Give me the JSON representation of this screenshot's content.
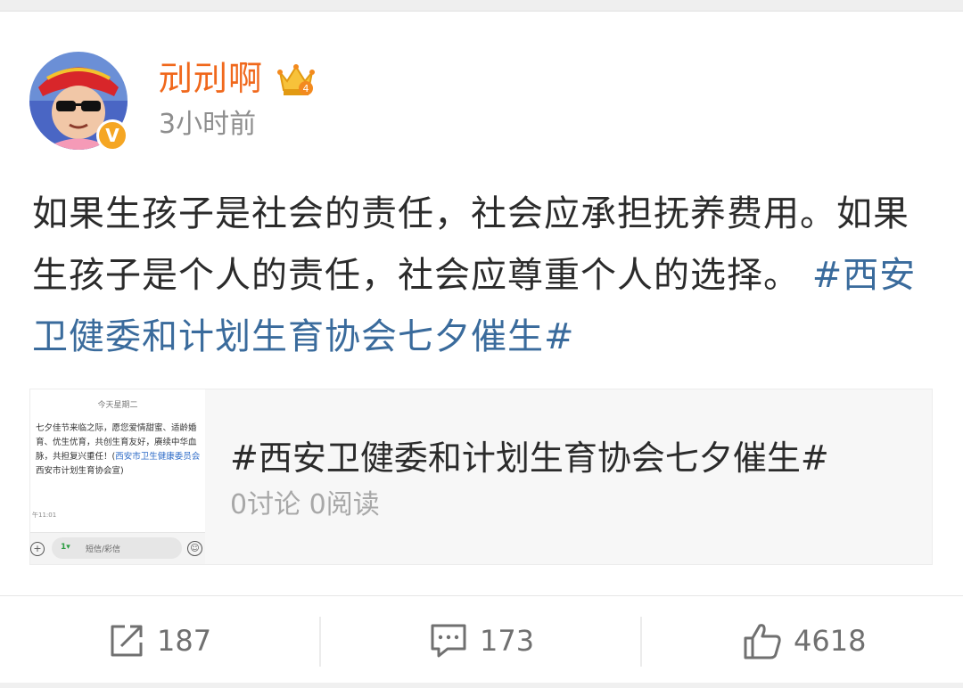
{
  "user": {
    "name": "刓刓啊",
    "time": "3小时前",
    "verify_mark": "V"
  },
  "post": {
    "text": "如果生孩子是社会的责任，社会应承担抚养费用。如果生孩子是个人的责任，社会应尊重个人的选择。",
    "hashtag": "#西安卫健委和计划生育协会七夕催生#"
  },
  "topic_card": {
    "title": "#西安卫健委和计划生育协会七夕催生#",
    "stats": "0讨论 0阅读",
    "thumbnail": {
      "header": "今天星期二",
      "message": "七夕佳节来临之际，愿您爱情甜蜜、适龄婚育、优生优育，共创生育友好，赓续中华血脉，共担复兴重任！(",
      "link": "西安市卫生健康委员会",
      "message_tail": "  西安市计划生育协会宣)",
      "time": "午11:01",
      "plus": "+",
      "sim": "1▾",
      "input_placeholder": "短信/彩信",
      "emoji": "☺"
    }
  },
  "actions": {
    "repost": "187",
    "comment": "173",
    "like": "4618"
  },
  "colors": {
    "username": "#f0681c",
    "hashtag": "#3a6b9c",
    "verify": "#f5a623",
    "muted": "#8e8e8e"
  },
  "icons": {
    "repost": "share-square-arrow-icon",
    "comment": "speech-bubble-icon",
    "like": "thumbs-up-icon",
    "crown": "crown-vip-icon",
    "verify": "verified-badge-icon"
  }
}
